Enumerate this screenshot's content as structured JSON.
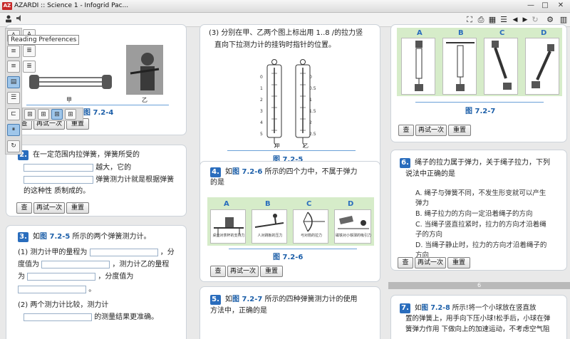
{
  "window": {
    "title": "AZARDI :: Science 1 - Infogrid Pac...",
    "logo": "AZ",
    "minimize": "—",
    "maximize": "□",
    "close": "✕"
  },
  "toolbar": {
    "fullscreen_icon": "⛶",
    "print_icon": "⎙",
    "grid_icon": "▦",
    "list_icon": "☰",
    "back_icon": "◀",
    "forward_icon": "▶",
    "reload_icon": "↻",
    "settings_icon": "⚙",
    "library_icon": "▥"
  },
  "side_panel": {
    "tooltip": "Reading Preferences"
  },
  "buttons": {
    "check": "查",
    "retry": "再试一次",
    "reset": "重置"
  },
  "col1": {
    "fig_label_a": "甲",
    "fig_label_b": "乙",
    "caption": "图 7.2-4",
    "q2": {
      "number": "2.",
      "line1": "在一定范围内拉弹簧，弹簧所受的",
      "line2": "越大，它的",
      "line3": "弹簧测力计就是根据弹簧",
      "line4": "的这种性  质制成的。"
    },
    "q3": {
      "number": "3.",
      "intro_pre": "如",
      "intro_ref": "图 7.2-5",
      "intro_post": " 所示的两个弹簧测力计。",
      "p1_a": "(1)  测力计甲的量程为",
      "p1_b": "，分",
      "p1_c": "度值为",
      "p1_d": "，测力计乙的量程",
      "p1_e": "为",
      "p1_f": "，分度值为",
      "p1_g": "。",
      "p2_a": "(2)  两个测力计比较，测力计",
      "p2_b": "的测量结果更准确。"
    }
  },
  "col2": {
    "q3_cont": {
      "line1": "(3)  分别在甲、乙两个图上标出用  1..8  /的拉力竖",
      "line2": "直向下拉测力计的挂钩时指针的位置。"
    },
    "gauge_a": "甲",
    "gauge_b": "乙",
    "gauge_ticks_a": [
      "0",
      "1",
      "2",
      "3",
      "4",
      "5"
    ],
    "gauge_ticks_b": [
      "0",
      "0.5",
      "1",
      "1.5",
      "2",
      "2.5"
    ],
    "caption_5": "图 7.2-5",
    "q4": {
      "number": "4.",
      "text_pre": "如",
      "text_ref": "图 7.2-6",
      "text_post": " 所示的四个力中，不属于弹力",
      "line2": "的是",
      "labels": [
        "A",
        "B",
        "C",
        "D"
      ],
      "subs": [
        "桌面对茶杯的支持力",
        "人对跳板的压力",
        "弓对箭的拉力",
        "磁铁对小铁球的吸引力"
      ]
    },
    "caption_6": "图 7.2-6",
    "q5": {
      "number": "5.",
      "text_pre": "如",
      "text_ref": "图 7.2-7",
      "text_post": " 所示的四种弹簧测力计的使用",
      "line2": "方法中，正确的是"
    }
  },
  "col3": {
    "labels": [
      "A",
      "B",
      "C",
      "D"
    ],
    "caption_7": "图 7.2-7",
    "q6": {
      "number": "6.",
      "line1": "绳子的拉力属于弹力，关于绳子拉力，下列",
      "line2": "说法中正确的是",
      "opt_a1": "A.  绳子与弹簧不同，不发生形变就可以产生",
      "opt_a2": "弹力",
      "opt_b": "B.  绳子拉力的方向一定沿着绳子的方向",
      "opt_c1": "C.  当绳子竖直拉紧时，拉力的方向才沿着绳",
      "opt_c2": "子的方向",
      "opt_d1": "D.  当绳子静止时，拉力的方向才沿着绳子的",
      "opt_d2": "方向"
    },
    "page_number": "6",
    "q7": {
      "number": "7.",
      "line1_pre": "如",
      "line1_ref": "图 7.2-8",
      "line1_post": " 所示!将一个小球放在竖直放",
      "line2": "置的弹簧上，用手向下压小球!松手后，小球在弹",
      "line3": "簧弹力作用  下做向上的加速运动，不考虑空气阻"
    }
  }
}
